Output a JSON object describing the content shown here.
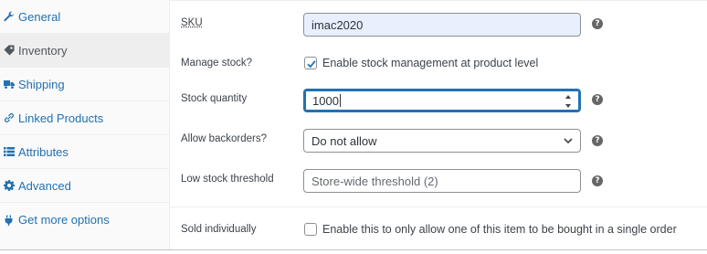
{
  "tabs": [
    {
      "label": "General",
      "icon": "wrench-icon",
      "active": false
    },
    {
      "label": "Inventory",
      "icon": "tag-icon",
      "active": true
    },
    {
      "label": "Shipping",
      "icon": "truck-icon",
      "active": false
    },
    {
      "label": "Linked Products",
      "icon": "link-icon",
      "active": false
    },
    {
      "label": "Attributes",
      "icon": "list-icon",
      "active": false
    },
    {
      "label": "Advanced",
      "icon": "gear-icon",
      "active": false
    },
    {
      "label": "Get more options",
      "icon": "plug-icon",
      "active": false
    }
  ],
  "fields": {
    "sku": {
      "label": "SKU",
      "value": "imac2020"
    },
    "manage_stock": {
      "label": "Manage stock?",
      "checkbox_label": "Enable stock management at product level",
      "checked": true
    },
    "stock_quantity": {
      "label": "Stock quantity",
      "value": "1000"
    },
    "backorders": {
      "label": "Allow backorders?",
      "selected": "Do not allow"
    },
    "low_stock": {
      "label": "Low stock threshold",
      "placeholder": "Store-wide threshold (2)"
    },
    "sold_individually": {
      "label": "Sold individually",
      "checkbox_label": "Enable this to only allow one of this item to be bought in a single order",
      "checked": false
    }
  },
  "help_icon_text": "?",
  "colors": {
    "link": "#2271b1",
    "focus": "#2271b1",
    "autofill": "#e8f0fe"
  }
}
